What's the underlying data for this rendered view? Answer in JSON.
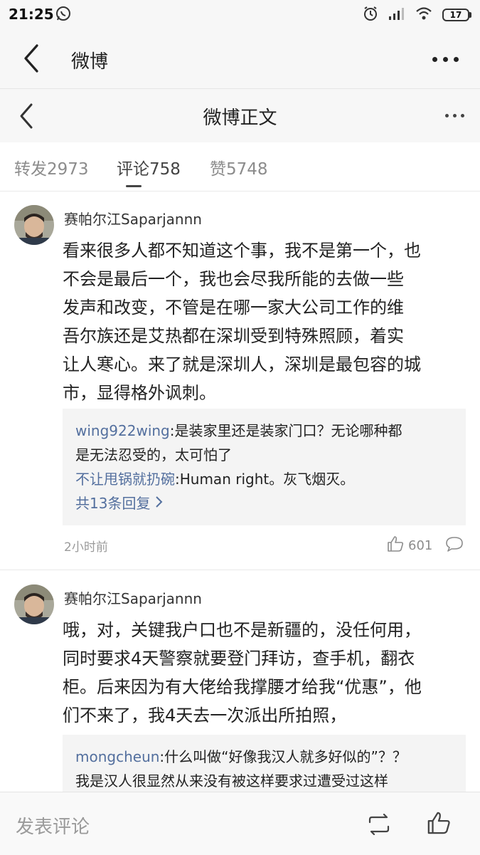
{
  "status": {
    "time": "21:25",
    "battery": "17"
  },
  "appbar": {
    "title": "微博"
  },
  "navbar": {
    "title": "微博正文"
  },
  "tabs": [
    {
      "label": "转发2973"
    },
    {
      "label": "评论758"
    },
    {
      "label": "赞5748"
    }
  ],
  "comments": [
    {
      "author": "赛帕尔江Saparjannn",
      "lines": [
        "看来很多人都不知道这个事，我不是第一个，也",
        "不会是最后一个，我也会尽我所能的去做一些",
        "发声和改变，不管是在哪一家大公司工作的维",
        "吾尔族还是艾热都在深圳受到特殊照顾，着实",
        "让人寒心。来了就是深圳人，深圳是最包容的城",
        "市，显得格外讽刺。"
      ],
      "replies": [
        {
          "name": "wing922wing",
          "text": ":是装家里还是装家门口？无论哪种都",
          "text2": "是无法忍受的，太可怕了"
        },
        {
          "name": "不让甩锅就扔碗",
          "text": ":Human right。灰飞烟灭。"
        }
      ],
      "more_replies": "共13条回复",
      "time": "2小时前",
      "likes": "601"
    },
    {
      "author": "赛帕尔江Saparjannn",
      "lines": [
        "哦，对，关键我户口也不是新疆的，没任何用，",
        "同时要求4天警察就要登门拜访，查手机，翻衣",
        "柜。后来因为有大佬给我撑腰才给我“优惠”，他",
        "们不来了，我4天去一次派出所拍照，"
      ],
      "replies": [
        {
          "name": "mongcheun",
          "text": ":什么叫做“好像我汉人就多好似的”？？",
          "text2": "我是汉人很显然从来没有被这样要求过遭受过这样"
        }
      ]
    }
  ],
  "bottombar": {
    "placeholder": "发表评论"
  },
  "colors": {
    "link": "#536f9e",
    "muted": "#9a9a9a",
    "bar": "#f7f7f7"
  },
  "icons": [
    "whatsapp-icon",
    "alarm-icon",
    "signal-icon",
    "wifi-icon",
    "battery-icon",
    "back-chevron-icon",
    "more-dots-icon",
    "thumbs-up-icon",
    "comment-bubble-icon",
    "repost-icon",
    "chevron-right-icon"
  ]
}
